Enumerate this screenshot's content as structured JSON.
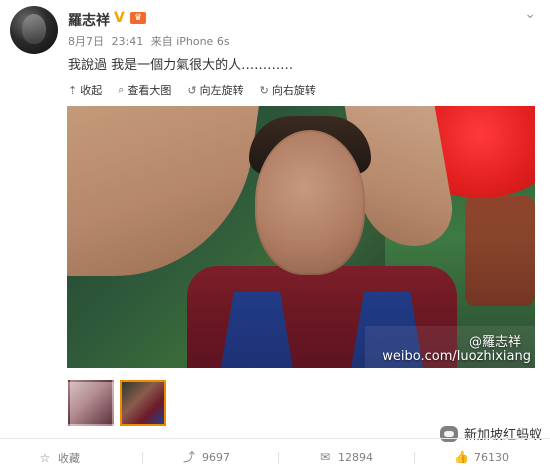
{
  "user": {
    "name": "羅志祥",
    "badge_v": "V",
    "badge_crown": "♛"
  },
  "post": {
    "meta": {
      "date": "8月7日",
      "time": "23:41",
      "source": "来自 iPhone 6s"
    },
    "text": "我說過 我是一個力氣很大的人…………",
    "caret": "⌄"
  },
  "toolbar": [
    {
      "label": "收起",
      "icon": "collapse-icon"
    },
    {
      "label": "查看大图",
      "icon": "search-icon"
    },
    {
      "label": "向左旋转",
      "icon": "rotate-left-icon"
    },
    {
      "label": "向右旋转",
      "icon": "rotate-right-icon"
    }
  ],
  "media": {
    "watermark_handle": "@羅志祥",
    "watermark_url": "weibo.com/luozhixiang"
  },
  "actions": {
    "favorite": "收藏",
    "repost": "9697",
    "comments": "12894",
    "likes": "76130"
  },
  "footer_watermark": "新加坡红蚂蚁"
}
